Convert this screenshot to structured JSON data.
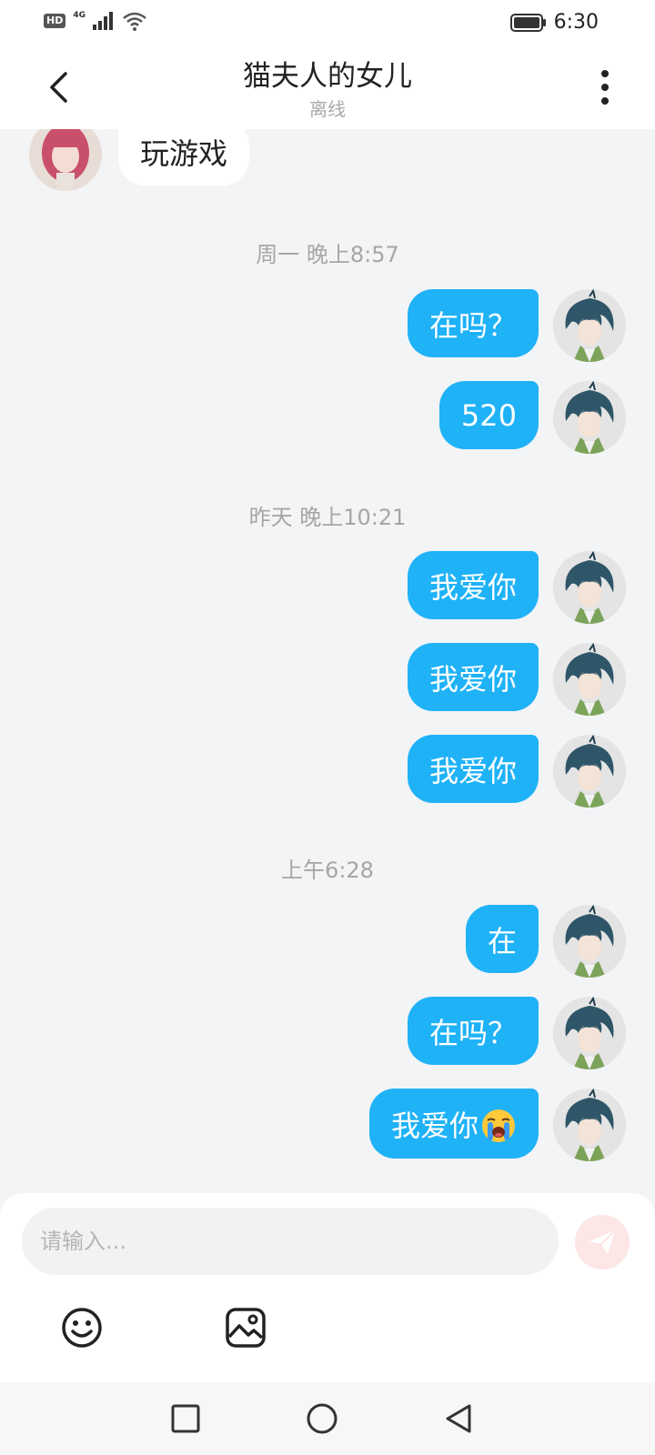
{
  "status_bar": {
    "hd": "HD",
    "network": "4G",
    "time": "6:30"
  },
  "header": {
    "title": "猫夫人的女儿",
    "subtitle": "离线"
  },
  "messages": [
    {
      "side": "in",
      "text": "玩游戏"
    },
    {
      "type": "time",
      "text": "周一 晚上8:57"
    },
    {
      "side": "out",
      "text": "在吗？"
    },
    {
      "side": "out",
      "text": "520"
    },
    {
      "type": "time",
      "text": "昨天 晚上10:21"
    },
    {
      "side": "out",
      "text": "我爱你"
    },
    {
      "side": "out",
      "text": "我爱你"
    },
    {
      "side": "out",
      "text": "我爱你"
    },
    {
      "type": "time",
      "text": "上午6:28"
    },
    {
      "side": "out",
      "text": "在"
    },
    {
      "side": "out",
      "text": "在吗？"
    },
    {
      "side": "out",
      "text": "我爱你",
      "emoji": "loudly-crying-face"
    }
  ],
  "input": {
    "placeholder": "请输入..."
  },
  "icons": {
    "back": "chevron-left-icon",
    "more": "more-vertical-icon",
    "send": "send-icon",
    "emoji": "smiley-icon",
    "image": "image-icon"
  },
  "colors": {
    "outgoing_bubble": "#1fb2f7",
    "incoming_bubble": "#ffffff",
    "background": "#f3f4f6",
    "send_button": "#fde6e6"
  }
}
